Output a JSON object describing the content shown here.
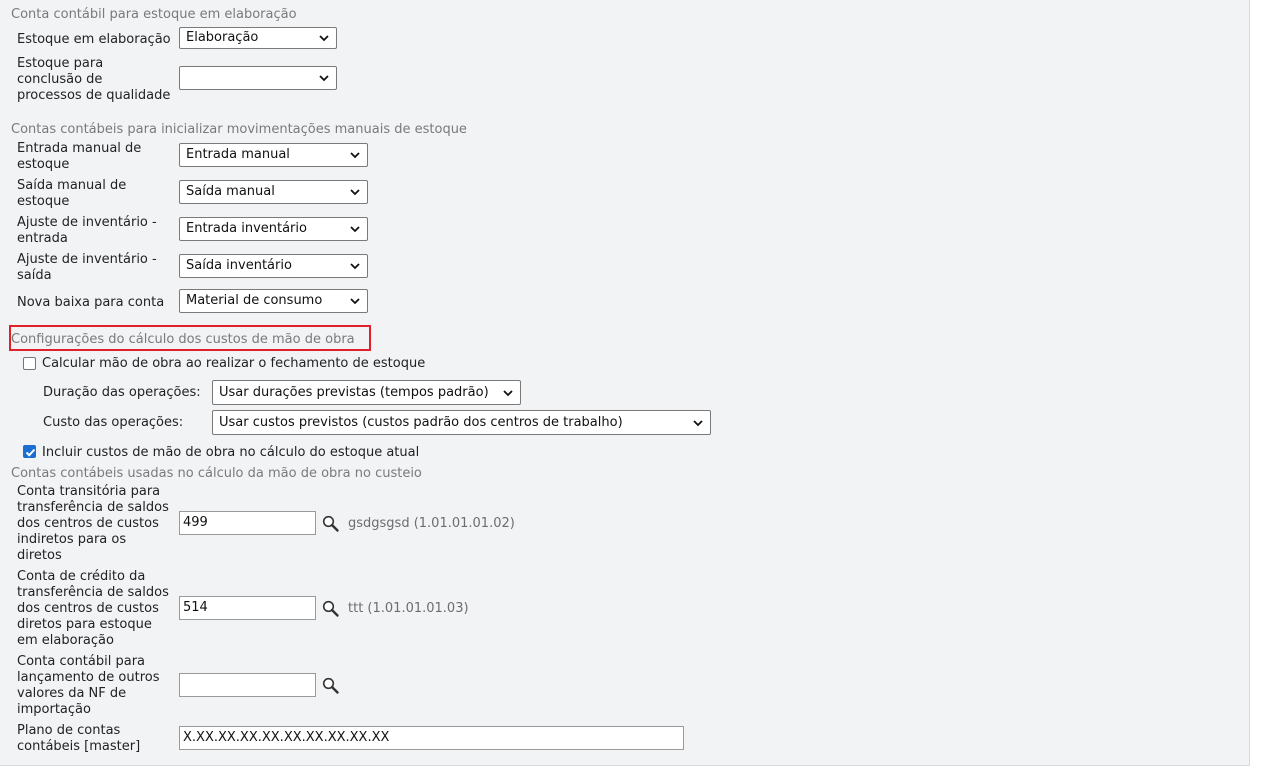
{
  "sections": {
    "elaboracao_title": "Conta contábil para estoque em elaboração",
    "manuais_title": "Contas contábeis para inicializar movimentações manuais de estoque",
    "mao_obra_title": "Configurações do cálculo dos custos de mão de obra",
    "custeio_title": "Contas contábeis usadas no cálculo da mão de obra no custeio"
  },
  "elaboracao": {
    "estoque_label": "Estoque em elaboração",
    "estoque_value": "Elaboração",
    "qualidade_label_1": "Estoque para",
    "qualidade_label_2": "conclusão de",
    "qualidade_label_3": "processos de qualidade",
    "qualidade_value": ""
  },
  "manuais": {
    "entrada_label_1": "Entrada manual de",
    "entrada_label_2": "estoque",
    "entrada_value": "Entrada manual",
    "saida_label_1": "Saída manual de",
    "saida_label_2": "estoque",
    "saida_value": "Saída manual",
    "aj_entrada_label_1": "Ajuste de inventário -",
    "aj_entrada_label_2": "entrada",
    "aj_entrada_value": "Entrada inventário",
    "aj_saida_label_1": "Ajuste de inventário -",
    "aj_saida_label_2": "saída",
    "aj_saida_value": "Saída inventário",
    "baixa_label": "Nova baixa para conta",
    "baixa_value": "Material de consumo"
  },
  "mao_obra": {
    "calcular_label": "Calcular mão de obra ao realizar o fechamento de estoque",
    "calcular_checked": false,
    "duracao_label": "Duração das operações:",
    "duracao_value": "Usar durações previstas (tempos padrão)",
    "custo_label": "Custo das operações:",
    "custo_value": "Usar custos previstos (custos padrão dos centros de trabalho)",
    "incluir_label": "Incluir custos de mão de obra no cálculo do estoque atual",
    "incluir_checked": true
  },
  "custeio": {
    "transitoria_label": [
      "Conta transitória para",
      "transferência de saldos",
      "dos centros de custos",
      "indiretos para os",
      "diretos"
    ],
    "transitoria_value": "499",
    "transitoria_desc": "gsdgsgsd (1.01.01.01.02)",
    "credito_label": [
      "Conta de crédito da",
      "transferência de saldos",
      "dos centros de custos",
      "diretos para estoque",
      "em elaboração"
    ],
    "credito_value": "514",
    "credito_desc": "ttt (1.01.01.01.03)",
    "nf_label": [
      "Conta contábil para",
      "lançamento de outros",
      "valores da NF de",
      "importação"
    ],
    "nf_value": "",
    "plano_label": [
      "Plano de contas",
      "contábeis [master]"
    ],
    "plano_value": "X.XX.XX.XX.XX.XX.XX.XX.XX.XX"
  },
  "icons": {
    "select_arrow": "chevron-down-icon",
    "lookup": "magnifier-icon",
    "checkmark": "check-icon"
  },
  "colors": {
    "highlight": "#e0202a",
    "checkbox_checked": "#1a6fd1",
    "panel_bg": "#f2f3f5"
  }
}
